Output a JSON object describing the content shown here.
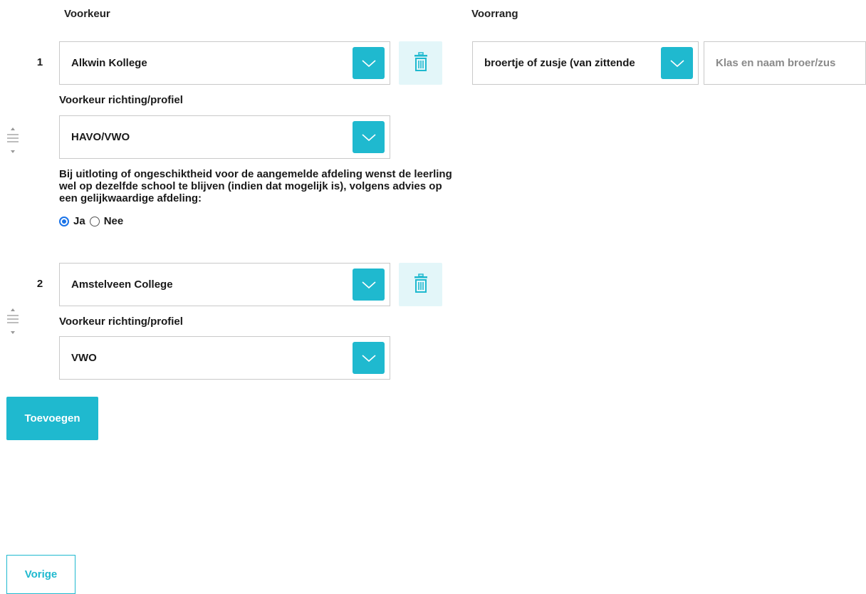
{
  "headers": {
    "preference": "Voorkeur",
    "priority": "Voorrang"
  },
  "preferences": [
    {
      "number": "1",
      "school": "Alkwin Kollege",
      "direction_label": "Voorkeur richting/profiel",
      "direction": "HAVO/VWO",
      "note": "Bij uitloting of ongeschiktheid voor de aangemelde afdeling wenst de leerling wel op dezelfde school te blijven (indien dat mogelijk is), volgens advies op een gelijkwaardige afdeling:",
      "radio": {
        "yes_label": "Ja",
        "no_label": "Nee",
        "selected": "Ja"
      }
    },
    {
      "number": "2",
      "school": "Amstelveen College",
      "direction_label": "Voorkeur richting/profiel",
      "direction": "VWO"
    }
  ],
  "priority": {
    "selected": "broertje of zusje (van zittende",
    "sibling_placeholder": "Klas en naam broer/zus"
  },
  "buttons": {
    "add": "Toevoegen",
    "previous": "Vorige"
  },
  "colors": {
    "accent": "#1fb9cf",
    "trash_bg": "#e3f6f9",
    "radio": "#1a73e8"
  },
  "icons": {
    "dropdown": "chevron-down-icon",
    "delete": "trash-icon",
    "drag": "drag-handle-icon"
  }
}
